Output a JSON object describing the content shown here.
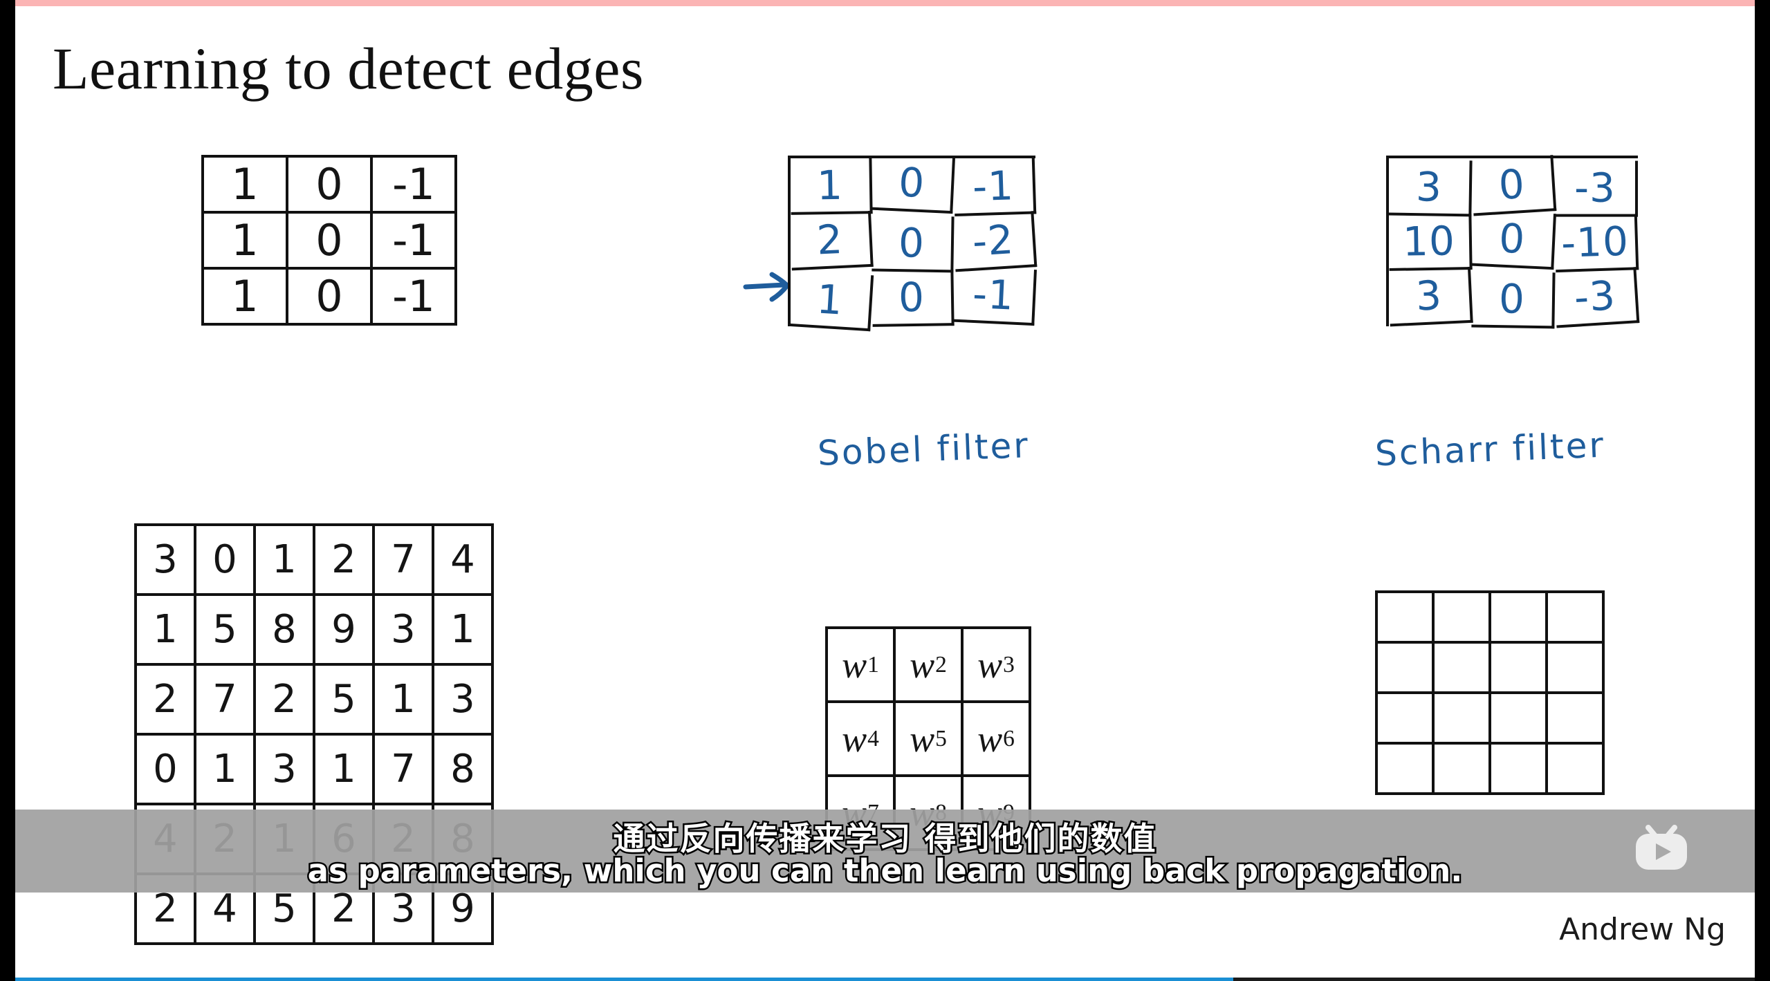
{
  "slide": {
    "title": "Learning to detect edges",
    "attribution": "Andrew Ng"
  },
  "filter_matrix": {
    "name": "vertical-edge-filter",
    "rows": [
      [
        "1",
        "0",
        "-1"
      ],
      [
        "1",
        "0",
        "-1"
      ],
      [
        "1",
        "0",
        "-1"
      ]
    ]
  },
  "sobel": {
    "label": "Sobel filter",
    "arrow_icon": "right-arrow-icon",
    "rows": [
      [
        "1",
        "0",
        "-1"
      ],
      [
        "2",
        "0",
        "-2"
      ],
      [
        "1",
        "0",
        "-1"
      ]
    ]
  },
  "scharr": {
    "label": "Scharr filter",
    "rows": [
      [
        "3",
        "0",
        "-3"
      ],
      [
        "10",
        "0",
        "-10"
      ],
      [
        "3",
        "0",
        "-3"
      ]
    ]
  },
  "input_matrix": {
    "name": "input-image-6x6",
    "rows": [
      [
        "3",
        "0",
        "1",
        "2",
        "7",
        "4"
      ],
      [
        "1",
        "5",
        "8",
        "9",
        "3",
        "1"
      ],
      [
        "2",
        "7",
        "2",
        "5",
        "1",
        "3"
      ],
      [
        "0",
        "1",
        "3",
        "1",
        "7",
        "8"
      ],
      [
        "4",
        "2",
        "1",
        "6",
        "2",
        "8"
      ],
      [
        "2",
        "4",
        "5",
        "2",
        "3",
        "9"
      ]
    ]
  },
  "weight_matrix": {
    "name": "learnable-weights-3x3",
    "symbol": "w",
    "subscripts": [
      [
        "1",
        "2",
        "3"
      ],
      [
        "4",
        "5",
        "6"
      ],
      [
        "7",
        "8",
        "9"
      ]
    ]
  },
  "output_matrix": {
    "name": "output-4x4",
    "rows": [
      [
        "",
        "",
        "",
        ""
      ],
      [
        "",
        "",
        "",
        ""
      ],
      [
        "",
        "",
        "",
        ""
      ],
      [
        "",
        "",
        "",
        ""
      ]
    ]
  },
  "subtitles": {
    "chinese": "通过反向传播来学习  得到他们的数值",
    "english": "as parameters, which you can then learn using back propagation."
  },
  "player": {
    "top_bar_color": "#fbb4b4",
    "bottom_bar_color": "#1a8fd4",
    "bottom_bar_progress_percent": "70",
    "watermark_icon": "bilibili-tv-play-icon"
  },
  "colors": {
    "ink_blue": "#1f5d9c",
    "grid_black": "#111111",
    "subtitle_band": "#a0a0a0"
  }
}
